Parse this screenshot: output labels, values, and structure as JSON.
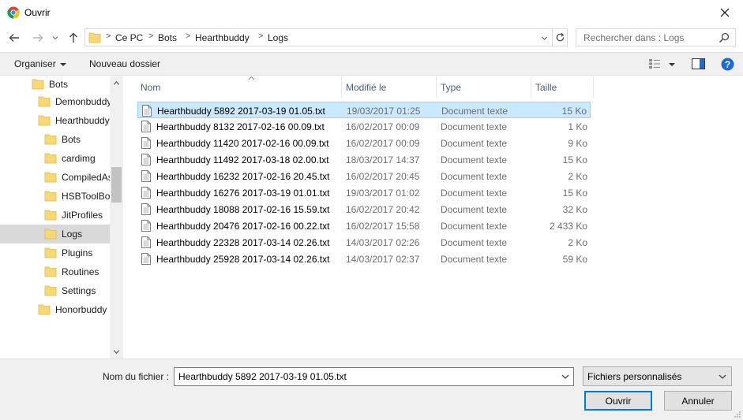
{
  "window": {
    "title": "Ouvrir"
  },
  "address": {
    "crumbs": [
      "Ce PC",
      "Bots",
      "Hearthbuddy",
      "Logs"
    ],
    "separator": ">"
  },
  "search": {
    "placeholder": "Rechercher dans : Logs"
  },
  "toolbar": {
    "organize_label": "Organiser",
    "new_folder_label": "Nouveau dossier",
    "help_icon": "?"
  },
  "tree": {
    "items": [
      {
        "label": "Bots",
        "level": 1,
        "selected": false
      },
      {
        "label": "Demonbuddy",
        "level": 2,
        "selected": false
      },
      {
        "label": "Hearthbuddy",
        "level": 2,
        "selected": false
      },
      {
        "label": "Bots",
        "level": 3,
        "selected": false
      },
      {
        "label": "cardimg",
        "level": 3,
        "selected": false
      },
      {
        "label": "CompiledAssemblies",
        "level": 3,
        "selected": false
      },
      {
        "label": "HSBToolBox",
        "level": 3,
        "selected": false
      },
      {
        "label": "JitProfiles",
        "level": 3,
        "selected": false
      },
      {
        "label": "Logs",
        "level": 3,
        "selected": true
      },
      {
        "label": "Plugins",
        "level": 3,
        "selected": false
      },
      {
        "label": "Routines",
        "level": 3,
        "selected": false
      },
      {
        "label": "Settings",
        "level": 3,
        "selected": false
      },
      {
        "label": "Honorbuddy",
        "level": 2,
        "selected": false
      }
    ]
  },
  "files": {
    "columns": {
      "name": "Nom",
      "date": "Modifié le",
      "type": "Type",
      "size": "Taille"
    },
    "rows": [
      {
        "name": "Hearthbuddy 5892 2017-03-19 01.05.txt",
        "date": "19/03/2017 01:25",
        "type": "Document texte",
        "size": "15 Ko",
        "selected": true
      },
      {
        "name": "Hearthbuddy 8132 2017-02-16 00.09.txt",
        "date": "16/02/2017 00:09",
        "type": "Document texte",
        "size": "1 Ko",
        "selected": false
      },
      {
        "name": "Hearthbuddy 11420 2017-02-16 00.09.txt",
        "date": "16/02/2017 00:09",
        "type": "Document texte",
        "size": "9 Ko",
        "selected": false
      },
      {
        "name": "Hearthbuddy 11492 2017-03-18 02.00.txt",
        "date": "18/03/2017 14:37",
        "type": "Document texte",
        "size": "15 Ko",
        "selected": false
      },
      {
        "name": "Hearthbuddy 16232 2017-02-16 20.45.txt",
        "date": "16/02/2017 20:45",
        "type": "Document texte",
        "size": "2 Ko",
        "selected": false
      },
      {
        "name": "Hearthbuddy 16276 2017-03-19 01.01.txt",
        "date": "19/03/2017 01:02",
        "type": "Document texte",
        "size": "15 Ko",
        "selected": false
      },
      {
        "name": "Hearthbuddy 18088 2017-02-16 15.59.txt",
        "date": "16/02/2017 20:42",
        "type": "Document texte",
        "size": "32 Ko",
        "selected": false
      },
      {
        "name": "Hearthbuddy 20476 2017-02-16 00.22.txt",
        "date": "16/02/2017 15:58",
        "type": "Document texte",
        "size": "2 433 Ko",
        "selected": false
      },
      {
        "name": "Hearthbuddy 22328 2017-03-14 02.26.txt",
        "date": "14/03/2017 02:26",
        "type": "Document texte",
        "size": "2 Ko",
        "selected": false
      },
      {
        "name": "Hearthbuddy 25928 2017-03-14 02.26.txt",
        "date": "14/03/2017 02:37",
        "type": "Document texte",
        "size": "59 Ko",
        "selected": false
      }
    ]
  },
  "footer": {
    "filename_label": "Nom du fichier :",
    "filename_value": "Hearthbuddy 5892 2017-03-19 01.05.txt",
    "filter_value": "Fichiers personnalisés",
    "open_label": "Ouvrir",
    "cancel_label": "Annuler"
  },
  "colors": {
    "folder": "#f8d775",
    "selection": "#cce8ff",
    "selection_border": "#99d1ff",
    "header_text": "#4c607a",
    "accent": "#0078d7",
    "help": "#1e6bc9"
  },
  "icons": {
    "app": "chrome-icon",
    "close": "close-icon",
    "back": "back-arrow-icon",
    "forward": "forward-arrow-icon",
    "recent": "chevron-down-icon",
    "up": "up-arrow-icon",
    "refresh": "refresh-icon",
    "search": "search-icon",
    "view": "view-details-icon",
    "preview": "preview-pane-icon",
    "help": "help-icon",
    "folder": "folder-icon",
    "file": "text-file-icon"
  }
}
